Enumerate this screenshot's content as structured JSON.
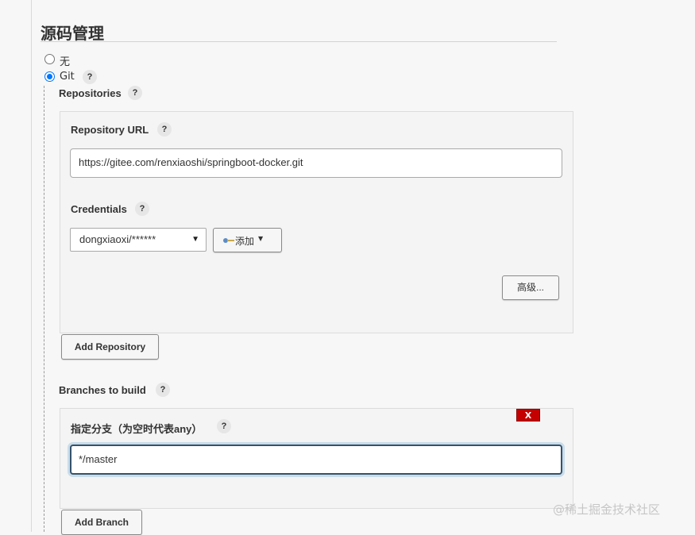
{
  "section": {
    "title": "源码管理"
  },
  "scm_options": [
    {
      "label": "无",
      "selected": false
    },
    {
      "label": "Git",
      "selected": true
    }
  ],
  "help_glyph": "?",
  "repositories": {
    "label": "Repositories",
    "repository_url": {
      "label": "Repository URL",
      "value": "https://gitee.com/renxiaoshi/springboot-docker.git"
    },
    "credentials": {
      "label": "Credentials",
      "selected": "dongxiaoxi/******",
      "add_label": "添加"
    },
    "advanced_label": "高级...",
    "add_repository_label": "Add Repository"
  },
  "branches": {
    "label": "Branches to build",
    "delete_label": "X",
    "specifier": {
      "label": "指定分支（为空时代表any）",
      "value": "*/master"
    },
    "add_branch_label": "Add Branch"
  },
  "watermark": "@稀土掘金技术社区",
  "colors": {
    "radio_selected": "#0075ff",
    "delete_button": "#c40000",
    "focus_border": "#35526b"
  }
}
